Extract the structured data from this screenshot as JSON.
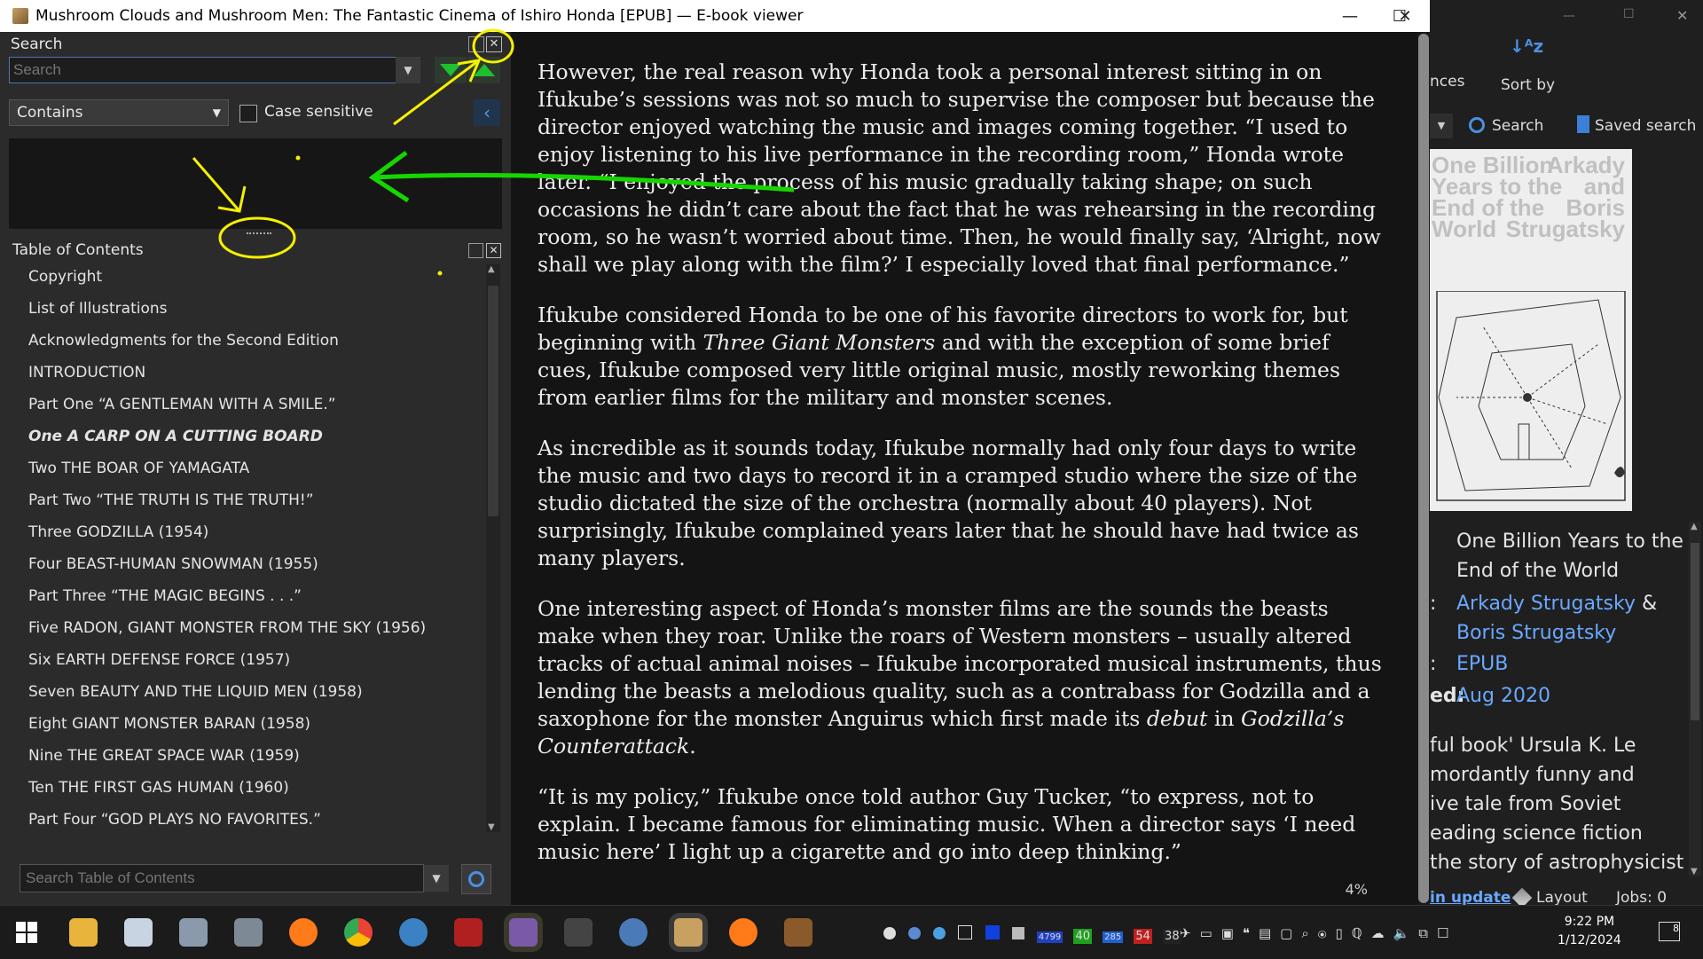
{
  "window": {
    "title": "Mushroom Clouds and Mushroom Men: The Fantastic Cinema of Ishiro Honda [EPUB] — E-book viewer"
  },
  "search_panel": {
    "title": "Search",
    "placeholder": "Search",
    "mode": "Contains",
    "case_label": "Case sensitive"
  },
  "toc": {
    "title": "Table of Contents",
    "items": [
      "Copyright",
      "List of Illustrations",
      "Acknowledgments for the Second Edition",
      "INTRODUCTION",
      "Part One “A GENTLEMAN WITH A SMILE.”",
      "One A CARP ON A CUTTING BOARD",
      "Two THE BOAR OF YAMAGATA",
      "Part Two “THE TRUTH IS THE TRUTH!”",
      "Three GODZILLA (1954)",
      "Four BEAST-HUMAN SNOWMAN (1955)",
      "Part Three “THE MAGIC BEGINS . . .”",
      "Five RADON, GIANT MONSTER FROM THE SKY (1956)",
      "Six EARTH DEFENSE FORCE (1957)",
      "Seven BEAUTY AND THE LIQUID MEN (1958)",
      "Eight GIANT MONSTER BARAN (1958)",
      "Nine THE GREAT SPACE WAR (1959)",
      "Ten THE FIRST GAS HUMAN (1960)",
      "Part Four “GOD PLAYS NO FAVORITES.”"
    ],
    "current_index": 5,
    "search_placeholder": "Search Table of Contents"
  },
  "reader": {
    "p1": "However, the real reason why Honda took a personal interest sitting in on Ifukube’s sessions was not so much to supervise the composer but because the director enjoyed watching the music and images coming together. “I used to enjoy listening to his live performance in the recording room,” Honda wrote later. “I enjoyed the process of his music gradually taking shape; on such occasions he didn’t care about the fact that he was rehearsing in the recording room, so he wasn’t worried about time. Then, he would finally say, ‘Alright, now shall we play along with the film?’ I especially loved that final performance.”",
    "p2a": "Ifukube considered Honda to be one of his favorite directors to work for, but beginning with ",
    "p2_em": "Three Giant Monsters",
    "p2b": " and with the exception of some brief cues, Ifukube composed very little original music, mostly reworking themes from earlier films for the military and monster scenes.",
    "p3": "As incredible as it sounds today, Ifukube normally had only four days to write the music and two days to record it in a cramped studio where the size of the studio dictated the size of the orchestra (normally about 40 players). Not surprisingly, Ifukube complained years later that he should have had twice as many players.",
    "p4a": "One interesting aspect of Honda’s monster films are the sounds the beasts make when they roar. Unlike the roars of Western monsters – usually altered tracks of actual animal noises – Ifukube incorporated musical instruments, thus lending the beasts a melodious quality, such as a contrabass for Godzilla and a saxophone for the monster Anguirus which first made its ",
    "p4_em1": "debut",
    "p4_mid": " in ",
    "p4_em2": "Godzilla’s Counterattack",
    "p4_end": ".",
    "p5": "“It is my policy,” Ifukube once told author Guy Tucker, “to express, not to explain. I became famous for eliminating music. When a director says ‘I need music here’ I light up a cigarette and go into deep thinking.”",
    "progress": "4%"
  },
  "calibre": {
    "toolbar_partial": "nces",
    "sort_by": "Sort by",
    "search": "Search",
    "saved_search": "Saved search",
    "cover": {
      "title_lines": [
        "One Billion",
        "Years to the",
        "End of the",
        "World"
      ],
      "author_lines": [
        "Arkady",
        "and",
        "Boris",
        "Strugatsky"
      ]
    },
    "book_title": "One Billion Years to the End of the World",
    "author1": "Arkady Strugatsky",
    "amp": "&",
    "author2": "Boris Strugatsky",
    "format": "EPUB",
    "published_label": "ed:",
    "published": "Aug 2020",
    "colon": ":",
    "desc": [
      "ful book' Ursula K. Le",
      " mordantly funny and",
      "ive tale from Soviet",
      "eading science fiction",
      " the story of astrophysicist"
    ],
    "status_update": "in update",
    "layout": "Layout",
    "jobs": "Jobs: 0"
  },
  "taskbar": {
    "time": "9:22 PM",
    "date": "1/12/2024",
    "tray_badges": [
      "4799",
      "40",
      "285",
      "54",
      "38"
    ],
    "notif_count": "8"
  },
  "colors": {
    "annotation_yellow": "#f5f000",
    "annotation_green": "#16d600",
    "link": "#6aa8ff"
  }
}
